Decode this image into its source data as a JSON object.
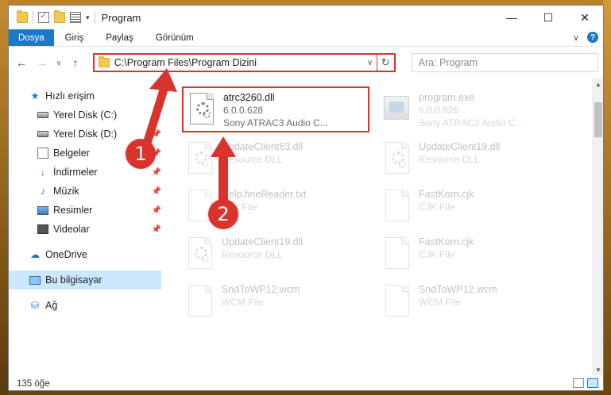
{
  "window": {
    "title": "Program",
    "controls": {
      "minimize": "—",
      "maximize": "☐",
      "close": "✕"
    }
  },
  "ribbon": {
    "tabs": [
      {
        "label": "Dosya",
        "active": true
      },
      {
        "label": "Giriş"
      },
      {
        "label": "Paylaş"
      },
      {
        "label": "Görünüm"
      }
    ],
    "expand_glyph": "∨",
    "help_glyph": "?"
  },
  "address": {
    "back": "←",
    "forward": "→",
    "recent": "∨",
    "up": "↑",
    "path": "C:\\Program Files\\Program Dizini",
    "dropdown": "∨",
    "refresh": "↻"
  },
  "search": {
    "placeholder": "Ara: Program"
  },
  "sidebar": {
    "items": [
      {
        "label": "Hızlı erişim",
        "icon": "star-icon"
      },
      {
        "label": "Yerel Disk (C:)",
        "icon": "disk-icon",
        "pinned": true
      },
      {
        "label": "Yerel Disk (D:)",
        "icon": "disk-icon",
        "pinned": true
      },
      {
        "label": "Belgeler",
        "icon": "documents-icon",
        "pinned": true
      },
      {
        "label": "İndirmeler",
        "icon": "download-icon",
        "pinned": true
      },
      {
        "label": "Müzik",
        "icon": "music-icon",
        "pinned": true
      },
      {
        "label": "Resimler",
        "icon": "pictures-icon",
        "pinned": true
      },
      {
        "label": "Videolar",
        "icon": "videos-icon",
        "pinned": true
      },
      {
        "label": "OneDrive",
        "icon": "cloud-icon"
      },
      {
        "label": "Bu bilgisayar",
        "icon": "computer-icon",
        "selected": true
      },
      {
        "label": "Ağ",
        "icon": "network-icon"
      }
    ]
  },
  "files": [
    {
      "name": "atrc3260.dll",
      "line2": "6.0.0.628",
      "line3": "Sony ATRAC3 Audio C...",
      "icon": "dll-gear-icon",
      "highlighted": true
    },
    {
      "name": "program.exe",
      "line2": "6.0.0.628",
      "line3": "Sony ATRAC3 Audio C...",
      "icon": "exe-icon",
      "faded": true
    },
    {
      "name": "UpdateClient63.dll",
      "line2": "Resource DLL",
      "icon": "dll-gear-icon",
      "faded": true
    },
    {
      "name": "UpdateClient19.dll",
      "line2": "Resource DLL",
      "icon": "dll-gear-icon",
      "faded": true
    },
    {
      "name": "Help.fineReader.txt",
      "line2": "Text File",
      "icon": "page-icon",
      "faded": true
    },
    {
      "name": "FastKorn.cjk",
      "line2": "CJK File",
      "icon": "page-icon",
      "faded": true
    },
    {
      "name": "UpdateClient19.dll",
      "line2": "Resource DLL",
      "icon": "dll-gear-icon",
      "faded": true
    },
    {
      "name": "FastKorn.cjk",
      "line2": "CJK File",
      "icon": "page-icon",
      "faded": true
    },
    {
      "name": "SndToWP12.wcm",
      "line2": "WCM File",
      "icon": "page-icon",
      "faded": true
    },
    {
      "name": "SndToWP12.wcm",
      "line2": "WCM File",
      "icon": "page-icon",
      "faded": true
    }
  ],
  "status": {
    "count": "135 öğe"
  },
  "annotations": {
    "badge1": "1",
    "badge2": "2",
    "color": "#d9342b"
  }
}
